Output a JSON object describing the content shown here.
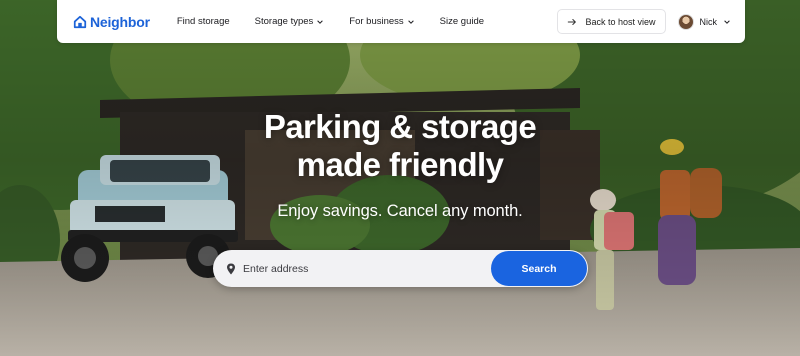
{
  "brand": {
    "name": "Neighbor",
    "color": "#1d63d8",
    "icon": "house-logo-icon"
  },
  "nav": {
    "links": [
      {
        "label": "Find storage",
        "has_dropdown": false
      },
      {
        "label": "Storage types",
        "has_dropdown": true
      },
      {
        "label": "For business",
        "has_dropdown": true
      },
      {
        "label": "Size guide",
        "has_dropdown": false
      }
    ],
    "host_button": {
      "label": "Back to host view",
      "icon": "arrow-right-icon"
    },
    "user": {
      "name": "Nick",
      "icon": "chevron-down-icon"
    }
  },
  "hero": {
    "headline_line1": "Parking & storage",
    "headline_line2": "made friendly",
    "subhead": "Enjoy savings. Cancel any month."
  },
  "search": {
    "placeholder": "Enter address",
    "value": "",
    "button_label": "Search",
    "icon": "location-pin-icon",
    "button_color": "#1a64e0"
  }
}
